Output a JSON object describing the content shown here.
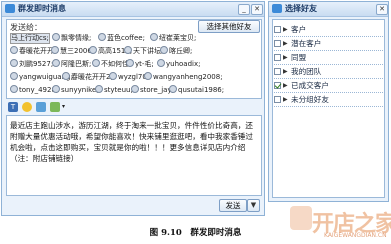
{
  "left_window": {
    "title": "群发即时消息",
    "to_label": "发送给：",
    "choose_button": "选择其他好友",
    "recipients": [
      "马上行动cs;",
      "飘零情缘;",
      "蓝色coffee;",
      "纽崔莱宝贝;",
      "春暖花开开;",
      "慧三2006;",
      "高高1515;",
      "天下讲坛;",
      "喀丘卿;",
      "刘鹏9527;",
      "阿隆巴斯;",
      "不如何佳;",
      "yt-毛;",
      "yuhoadix;",
      "yangwuiguang;",
      "春暖花开开2;",
      "wyzgl70;",
      "wangyanheng2008;",
      "tony_4928;",
      "sunyynike;",
      "styteuu;",
      "store_jay;",
      "qusutai1986;"
    ],
    "message": "最近店主跑山涉水，游历江湖，终于淘来一批宝贝，件件性价比奇高，还附赠大量优惠活动哦，希望你能喜欢！快来铺里逛逛吧，看中我家香锤过机会啦，点击这即购买，宝贝就是你的啦！！！更多信息详见店内介绍（注：附店铺链接）",
    "send_button": "发送",
    "send_arrow": "▼",
    "toolbar_icons": [
      "font-icon",
      "emoji-icon",
      "image-icon",
      "screenshot-icon"
    ]
  },
  "right_window": {
    "title": "选择好友",
    "groups": [
      {
        "name": "客户",
        "checked": false
      },
      {
        "name": "潜在客户",
        "checked": false
      },
      {
        "name": "同盟",
        "checked": false
      },
      {
        "name": "我的团队",
        "checked": false
      },
      {
        "name": "已成交客户",
        "checked": true
      },
      {
        "name": "未分组好友",
        "checked": false
      }
    ]
  },
  "caption": "图 9.10　群发即时消息",
  "watermark": {
    "chinese": "开店之家",
    "english": "KAIGEWANGDIAN.CN"
  },
  "colors": {
    "window_bg": "#eaf2fb",
    "border": "#8fb2d6",
    "title_text": "#1b3a66"
  }
}
